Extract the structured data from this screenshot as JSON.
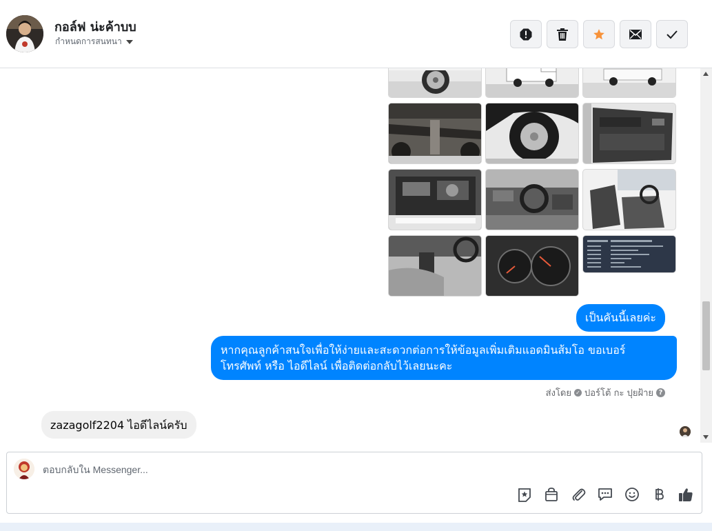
{
  "header": {
    "contact_name": "กอล์ฟ น่ะค้าบบ",
    "assign_label": "กำหนดการสนทนา",
    "actions": [
      {
        "name": "spam-button",
        "icon": "exclamation-icon",
        "color": "#1c1e21"
      },
      {
        "name": "delete-button",
        "icon": "trash-icon",
        "color": "#1c1e21"
      },
      {
        "name": "star-button",
        "icon": "star-icon",
        "color": "#f7923a"
      },
      {
        "name": "mark-unread-button",
        "icon": "envelope-icon",
        "color": "#1c1e21"
      },
      {
        "name": "done-button",
        "icon": "checkmark-icon",
        "color": "#1c1e21"
      }
    ]
  },
  "conversation": {
    "photo_grid": [
      "car-side-wheel",
      "pickup-rear",
      "pickup-side",
      "undercarriage",
      "spare-tire",
      "door-interior",
      "engine-bay",
      "dashboard-steering",
      "front-seats",
      "gear-console",
      "gauge-cluster",
      "spec-sheet"
    ],
    "outgoing_1": "เป็นคันนี้เลยค่ะ",
    "outgoing_2_line1": "หากคุณลูกค้าสนใจเพื่อให้ง่ายและสะดวกต่อการให้ข้อมูลเพิ่มเติมแอดมินส้มโอ ขอเบอร์",
    "outgoing_2_line2": "โทรศัพท์ หรือ ไอดีไลน์ เพื่อติดต่อกลับไว้เลยนะคะ",
    "sent_by_prefix": "ส่งโดย",
    "sent_by_name": "ปอร์โต้ กะ ปุยฝ้าย",
    "incoming_1": "zazagolf2204 ไอดีไลน์ครับ"
  },
  "composer": {
    "placeholder": "ตอบกลับใน Messenger...",
    "tools": [
      "sticker-icon",
      "shop-bag-icon",
      "paperclip-icon",
      "saved-reply-icon",
      "emoji-icon",
      "baht-icon",
      "thumbs-up-icon"
    ]
  },
  "colors": {
    "brand_blue": "#0084ff",
    "star_orange": "#f7923a",
    "incoming_bg": "#f0f0f0"
  }
}
